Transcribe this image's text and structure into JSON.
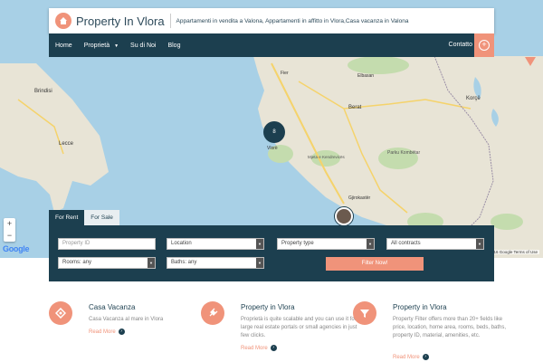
{
  "header": {
    "site_title": "Property In Vlora",
    "tagline": "Appartamenti in vendita a Valona, Appartamenti in affitto in Vlora,Casa vacanza in Valona"
  },
  "nav": {
    "items": [
      {
        "label": "Home"
      },
      {
        "label": "Proprietà"
      },
      {
        "label": "Su di Noi"
      },
      {
        "label": "Blog"
      }
    ],
    "contact_label": "Contatto",
    "plus_symbol": "+"
  },
  "map": {
    "cluster_count": "8",
    "zoom_in": "+",
    "zoom_out": "−",
    "google_label": "Google",
    "footer_text": "Map data ©2016 Google   Terms of Use",
    "place_labels": [
      "Brindisi",
      "Lecce",
      "Fier",
      "Berat",
      "Vlorë",
      "Korçë",
      "Elbasan",
      "Gjirokastër",
      "Sarandë",
      "Tirana",
      "Ohrid",
      "Durrës",
      "Parku Kombëtar Valbona",
      "Parku Kombëtar i Bredhit të Hotovës",
      "Mjeta e Kendrevicës"
    ],
    "colors": {
      "sea": "#a8d0e6",
      "land": "#e8e4d6",
      "park": "#c4dcae",
      "road": "#f5d36b",
      "cluster": "#1c3f4f"
    }
  },
  "search": {
    "tabs": [
      {
        "label": "For Rent"
      },
      {
        "label": "For Sale"
      }
    ],
    "property_id_placeholder": "Property ID",
    "location_value": "Location",
    "property_type_value": "Property type",
    "contracts_value": "All contracts",
    "rooms_value": "Rooms: any",
    "baths_value": "Baths: any",
    "filter_button": "Filter Now!"
  },
  "features": [
    {
      "icon": "location-diamond-icon",
      "title": "Casa Vacanza",
      "desc": "Casa Vacanza al mare in Vlora",
      "more": "Read More"
    },
    {
      "icon": "plug-icon",
      "title": "Property in Vlora",
      "desc": "Proprietà is quite scalable and you can use it for large real estate portals or small agencies in just few clicks.",
      "more": "Read More"
    },
    {
      "icon": "filter-icon",
      "title": "Property in Vlora",
      "desc": "Property Filter offers more than 20+ fields like price, location, home area, rooms, beds, baths, property ID, material, amenities, etc.",
      "more": "Read More"
    }
  ],
  "colors": {
    "accent": "#f0937a",
    "primary": "#1c3f4f"
  }
}
